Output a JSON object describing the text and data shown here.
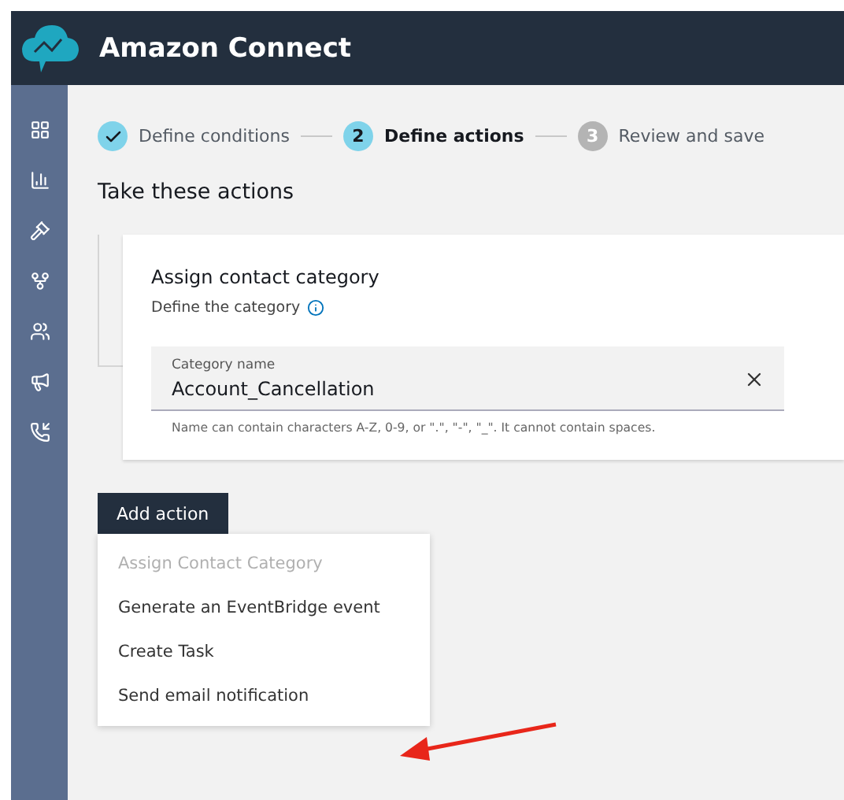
{
  "header": {
    "title": "Amazon Connect"
  },
  "steps": [
    {
      "label": "Define conditions",
      "completed": true,
      "selected": false
    },
    {
      "marker": "2",
      "label": "Define actions",
      "completed": false,
      "selected": true
    },
    {
      "marker": "3",
      "label": "Review and save",
      "completed": false,
      "selected": false
    }
  ],
  "heading": "Take these actions",
  "card": {
    "title": "Assign contact category",
    "subtitle": "Define the category",
    "field": {
      "label": "Category name",
      "value": "Account_Cancellation",
      "hint": "Name can contain characters A-Z, 0-9, or \".\", \"-\", \"_\". It cannot contain spaces."
    }
  },
  "add_button": "Add action",
  "menu": [
    {
      "label": "Assign Contact Category",
      "disabled": true
    },
    {
      "label": "Generate an EventBridge event",
      "disabled": false
    },
    {
      "label": "Create Task",
      "disabled": false
    },
    {
      "label": "Send email notification",
      "disabled": false
    }
  ]
}
